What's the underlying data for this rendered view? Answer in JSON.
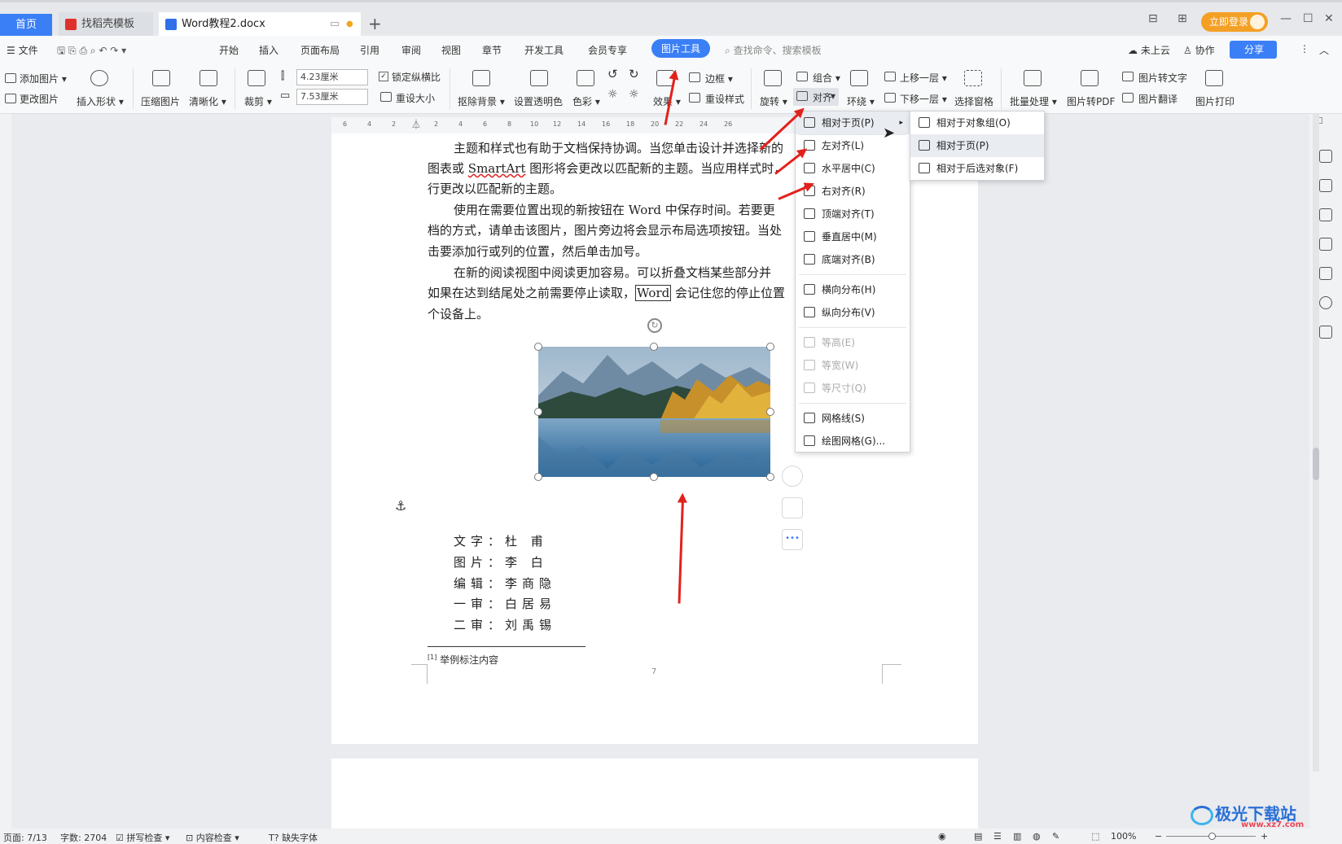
{
  "tabs": {
    "home": "首页",
    "template": "找稻壳模板",
    "doc": "Word教程2.docx",
    "new_tab": "+"
  },
  "title_right": {
    "login": "立即登录"
  },
  "menu": {
    "file": "文件",
    "items": [
      "开始",
      "插入",
      "页面布局",
      "引用",
      "审阅",
      "视图",
      "章节",
      "开发工具",
      "会员专享"
    ],
    "active": "图片工具",
    "search": "查找命令、搜索模板",
    "cloud": "未上云",
    "collab": "协作",
    "share": "分享"
  },
  "ribbon": {
    "add_image": "添加图片",
    "change_image": "更改图片",
    "insert_shape": "插入形状",
    "compress": "压缩图片",
    "sharpen": "清晰化",
    "crop": "裁剪",
    "height": "4.23厘米",
    "width": "7.53厘米",
    "lock_ratio": "锁定纵横比",
    "resize": "重设大小",
    "remove_bg": "抠除背景",
    "set_transparent": "设置透明色",
    "color": "色彩",
    "effects": "效果",
    "border": "边框",
    "reset_style": "重设样式",
    "rotate": "旋转",
    "group": "组合",
    "align": "对齐",
    "wrap": "环绕",
    "bring_forward": "上移一层",
    "send_backward": "下移一层",
    "select_pane": "选择窗格",
    "batch": "批量处理",
    "to_pdf": "图片转PDF",
    "to_text": "图片转文字",
    "translate": "图片翻译",
    "print": "图片打印"
  },
  "ruler": {
    "ticks": [
      "6",
      "4",
      "2",
      "2",
      "4",
      "6",
      "8",
      "10",
      "12",
      "14",
      "16",
      "18",
      "20",
      "22",
      "24",
      "26"
    ]
  },
  "doc": {
    "p1a": "主题和样式也有助于文档保持协调。当您单击设计并选择新的",
    "p1b": "图表或",
    "p1b_link": "SmartArt",
    "p1b2": "图形将会更改以匹配新的主题。当应用样式时，",
    "p1c": "行更改以匹配新的主题。",
    "p2a": "使用在需要位置出现的新按钮在",
    "p2a_word": "Word",
    "p2a2": "中保存时间。若要更",
    "p3a": "档的方式，请单击该图片，图片旁边将会显示布局选项按钮。当处",
    "p3b": "击要添加行或列的位置，然后单击加号。",
    "p4a": "在新的阅读视图中阅读更加容易。可以折叠文档某些部分并",
    "p4b": "如果在达到结尾处之前需要停止读取，",
    "p4b_word": "Word",
    "p4b2": "会记住您的停止位置",
    "p4c": "个设备上。",
    "credits": [
      {
        "k": "文字：",
        "v": "杜 甫"
      },
      {
        "k": "图片：",
        "v": "李 白"
      },
      {
        "k": "编辑：",
        "v": "李商隐"
      },
      {
        "k": "一审：",
        "v": "白居易"
      },
      {
        "k": "二审：",
        "v": "刘禹锡"
      }
    ],
    "footnote_mark": "[1]",
    "footnote": "举例标注内容",
    "page_num": "7"
  },
  "align_menu": {
    "items": [
      {
        "label": "相对于页(P)",
        "state": "hl"
      },
      {
        "label": "左对齐(L)"
      },
      {
        "label": "水平居中(C)"
      },
      {
        "label": "右对齐(R)"
      },
      {
        "label": "顶端对齐(T)"
      },
      {
        "label": "垂直居中(M)"
      },
      {
        "label": "底端对齐(B)"
      },
      {
        "label": "横向分布(H)"
      },
      {
        "label": "纵向分布(V)"
      },
      {
        "label": "等高(E)",
        "state": "dis"
      },
      {
        "label": "等宽(W)",
        "state": "dis"
      },
      {
        "label": "等尺寸(Q)",
        "state": "dis"
      },
      {
        "label": "网格线(S)"
      },
      {
        "label": "绘图网格(G)..."
      }
    ]
  },
  "sub_menu": {
    "items": [
      "相对于对象组(O)",
      "相对于页(P)",
      "相对于后选对象(F)"
    ]
  },
  "status": {
    "page": "页面: 7/13",
    "words": "字数: 2704",
    "spell": "拼写检查",
    "content": "内容检查",
    "font": "缺失字体",
    "zoom": "100%"
  },
  "watermark": {
    "name": "极光下载站",
    "url": "www.xz7.com"
  }
}
